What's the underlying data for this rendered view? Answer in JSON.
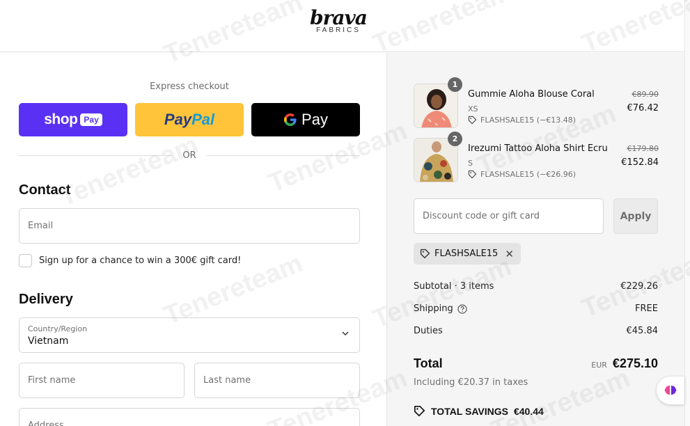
{
  "header": {
    "logo_main": "brava",
    "logo_sub": "FABRICS"
  },
  "express": {
    "label": "Express checkout",
    "shop_label": "shop",
    "shop_badge": "Pay",
    "paypal_part1": "Pay",
    "paypal_part2": "Pal",
    "gpay_label": "Pay",
    "or_label": "OR"
  },
  "contact": {
    "title": "Contact",
    "email_placeholder": "Email",
    "newsletter_label": "Sign up for a chance to win a 300€ gift card!"
  },
  "delivery": {
    "title": "Delivery",
    "country_label": "Country/Region",
    "country_value": "Vietnam",
    "first_name_placeholder": "First name",
    "last_name_placeholder": "Last name",
    "address_placeholder": "Address"
  },
  "cart": {
    "items": [
      {
        "name": "Gummie Aloha Blouse Coral",
        "variant": "XS",
        "discount": "FLASHSALE15 (−€13.48)",
        "old_price": "€89.90",
        "price": "€76.42",
        "quantity": "1"
      },
      {
        "name": "Irezumi Tattoo Aloha Shirt Ecru",
        "variant": "S",
        "discount": "FLASHSALE15 (−€26.96)",
        "old_price": "€179.80",
        "price": "€152.84",
        "quantity": "2"
      }
    ],
    "discount_placeholder": "Discount code or gift card",
    "apply_label": "Apply",
    "applied_code": "FLASHSALE15",
    "subtotal_label": "Subtotal · 3 items",
    "subtotal_value": "€229.26",
    "shipping_label": "Shipping",
    "shipping_value": "FREE",
    "duties_label": "Duties",
    "duties_value": "€45.84",
    "total_label": "Total",
    "currency": "EUR",
    "total_value": "€275.10",
    "tax_line": "Including €20.37 in taxes",
    "savings_label": "TOTAL SAVINGS",
    "savings_value": "€40.44"
  },
  "watermark": "Tenereteam",
  "colors": {
    "shop_pay": "#5a31f4",
    "paypal": "#ffc439",
    "gpay": "#000000",
    "summary_bg": "#f5f5f5"
  }
}
